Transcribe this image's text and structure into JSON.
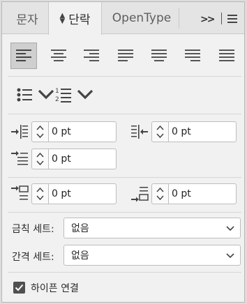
{
  "tabs": {
    "character": "문자",
    "paragraph": "단락",
    "opentype": "OpenType",
    "overflow": ">>"
  },
  "alignment": {
    "buttons": [
      "align-left",
      "align-center",
      "align-right",
      "justify-last-left",
      "justify-last-center",
      "justify-last-right",
      "justify-all"
    ],
    "active": "align-left"
  },
  "lists": {
    "bullet_icon": "bullet-list-icon",
    "numbered_icon": "numbered-list-icon"
  },
  "indents": {
    "left_indent": "0 pt",
    "right_indent": "0 pt",
    "first_line_indent": "0 pt",
    "space_before": "0 pt",
    "space_after": "0 pt"
  },
  "kinsoku": {
    "label": "금칙 세트:",
    "value": "없음"
  },
  "mojikumi": {
    "label": "간격 세트:",
    "value": "없음"
  },
  "hyphenate": {
    "label": "하이픈 연결",
    "checked": true
  },
  "colors": {
    "panel_bg": "#f1f1f1",
    "tab_bg": "#e4e4e4",
    "active_button": "#cfcfcf",
    "checkbox": "#505050"
  }
}
